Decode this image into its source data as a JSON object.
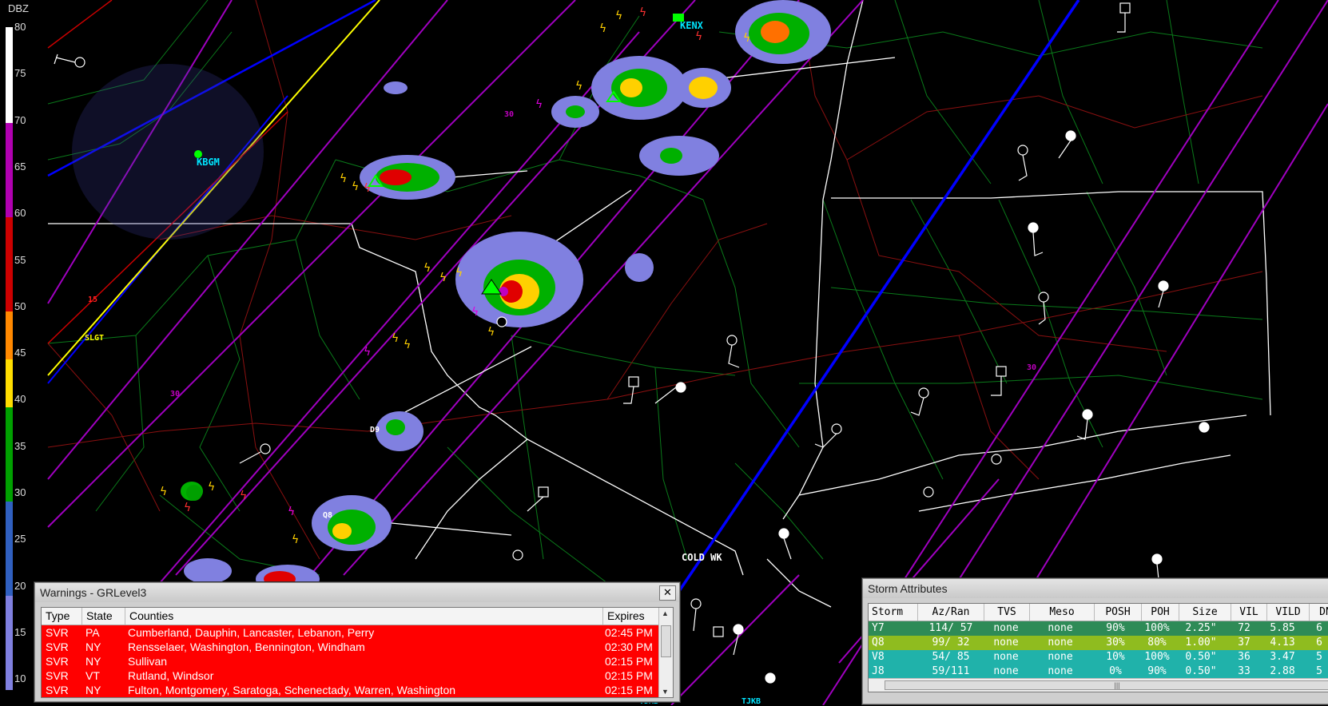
{
  "app": {
    "warnings_title": "Warnings - GRLevel3",
    "storms_title": "Storm Attributes",
    "close_glyph": "✕"
  },
  "legend": {
    "title": "DBZ",
    "ticks": [
      "80",
      "75",
      "70",
      "65",
      "60",
      "55",
      "50",
      "45",
      "40",
      "35",
      "30",
      "25",
      "20",
      "15",
      "10"
    ]
  },
  "map_labels": {
    "kbgm": "KBGM",
    "kenx": "KENX",
    "slgt": "SLGT",
    "cold_wk": "COLD WK",
    "d9": "D9",
    "q8": "Q8",
    "n15": "15",
    "n30a": "30",
    "n30b": "30",
    "n30c": "30",
    "tdmb": "TDMB",
    "tdkb": "TJKB"
  },
  "colors": {
    "warning_bg": "#ff0000",
    "cyan_label": "#00e5ff",
    "magenta_line": "#a000c0",
    "blue_line": "#0000ff",
    "yellow_line": "#ffff00"
  },
  "warnings": {
    "headers": {
      "type": "Type",
      "state": "State",
      "counties": "Counties",
      "expires": "Expires"
    },
    "rows": [
      {
        "type": "SVR",
        "state": "PA",
        "counties": "Cumberland, Dauphin, Lancaster, Lebanon, Perry",
        "expires": "02:45 PM"
      },
      {
        "type": "SVR",
        "state": "NY",
        "counties": "Rensselaer, Washington, Bennington, Windham",
        "expires": "02:30 PM"
      },
      {
        "type": "SVR",
        "state": "NY",
        "counties": "Sullivan",
        "expires": "02:15 PM"
      },
      {
        "type": "SVR",
        "state": "VT",
        "counties": "Rutland, Windsor",
        "expires": "02:15 PM"
      },
      {
        "type": "SVR",
        "state": "NY",
        "counties": "Fulton, Montgomery, Saratoga, Schenectady, Warren, Washington",
        "expires": "02:15 PM"
      }
    ]
  },
  "storms": {
    "headers": {
      "storm": "Storm",
      "az": "Az/Ran",
      "tvs": "TVS",
      "meso": "Meso",
      "posh": "POSH",
      "poh": "POH",
      "size": "Size",
      "vil": "VIL",
      "vild": "VILD",
      "dn": "DN"
    },
    "rows": [
      {
        "storm": "Y7",
        "az": "114/ 57",
        "tvs": "none",
        "meso": "none",
        "posh": "90%",
        "poh": "100%",
        "size": "2.25\"",
        "vil": "72",
        "vild": "5.85",
        "dn": "6",
        "color": "#2e8b57"
      },
      {
        "storm": "Q8",
        "az": "99/ 32",
        "tvs": "none",
        "meso": "none",
        "posh": "30%",
        "poh": "80%",
        "size": "1.00\"",
        "vil": "37",
        "vild": "4.13",
        "dn": "6",
        "color": "#8fbc1f"
      },
      {
        "storm": "V8",
        "az": "54/ 85",
        "tvs": "none",
        "meso": "none",
        "posh": "10%",
        "poh": "100%",
        "size": "0.50\"",
        "vil": "36",
        "vild": "3.47",
        "dn": "5",
        "color": "#20b2aa"
      },
      {
        "storm": "J8",
        "az": "59/111",
        "tvs": "none",
        "meso": "none",
        "posh": "0%",
        "poh": "90%",
        "size": "0.50\"",
        "vil": "33",
        "vild": "2.88",
        "dn": "5",
        "color": "#20b2aa"
      }
    ]
  }
}
